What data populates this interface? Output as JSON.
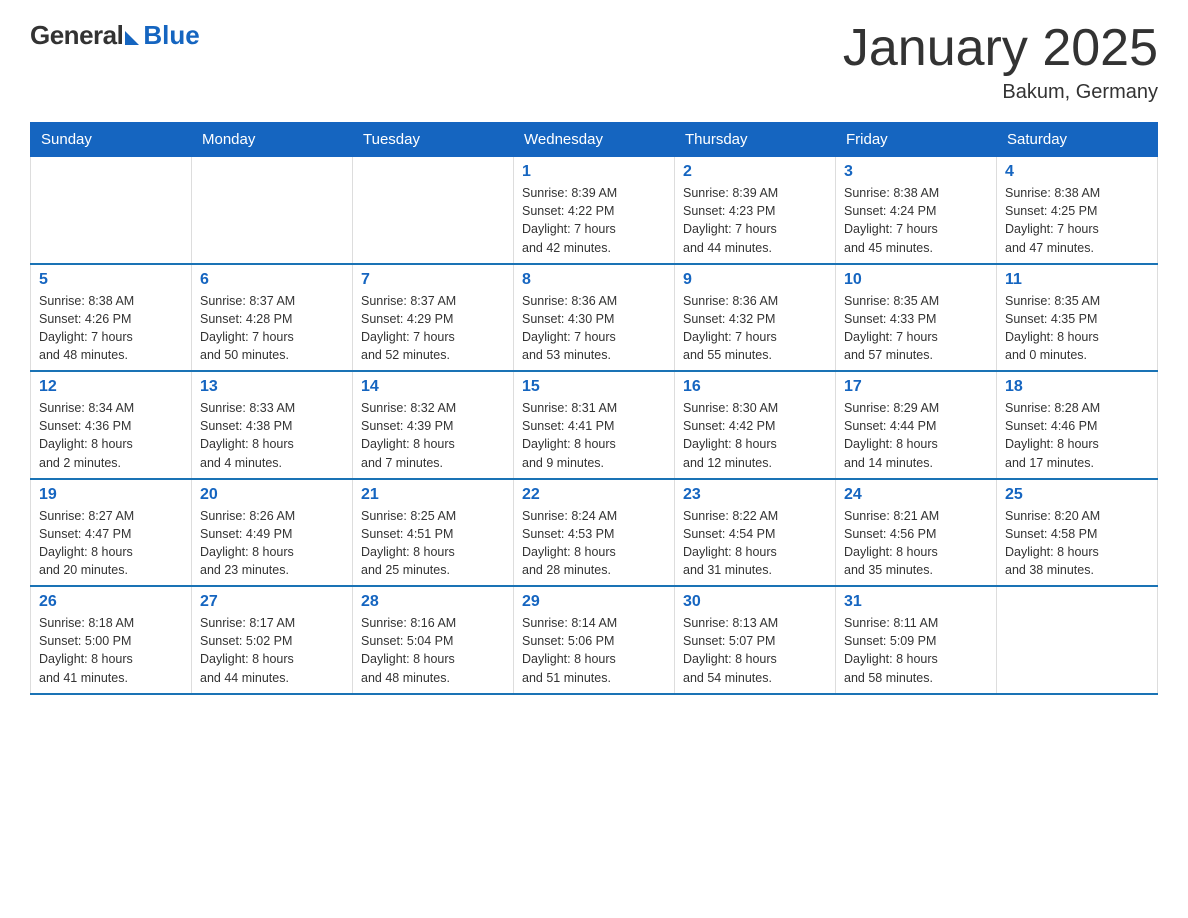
{
  "header": {
    "logo_general": "General",
    "logo_blue": "Blue",
    "title": "January 2025",
    "location": "Bakum, Germany"
  },
  "weekdays": [
    "Sunday",
    "Monday",
    "Tuesday",
    "Wednesday",
    "Thursday",
    "Friday",
    "Saturday"
  ],
  "weeks": [
    [
      {
        "day": "",
        "info": ""
      },
      {
        "day": "",
        "info": ""
      },
      {
        "day": "",
        "info": ""
      },
      {
        "day": "1",
        "info": "Sunrise: 8:39 AM\nSunset: 4:22 PM\nDaylight: 7 hours\nand 42 minutes."
      },
      {
        "day": "2",
        "info": "Sunrise: 8:39 AM\nSunset: 4:23 PM\nDaylight: 7 hours\nand 44 minutes."
      },
      {
        "day": "3",
        "info": "Sunrise: 8:38 AM\nSunset: 4:24 PM\nDaylight: 7 hours\nand 45 minutes."
      },
      {
        "day": "4",
        "info": "Sunrise: 8:38 AM\nSunset: 4:25 PM\nDaylight: 7 hours\nand 47 minutes."
      }
    ],
    [
      {
        "day": "5",
        "info": "Sunrise: 8:38 AM\nSunset: 4:26 PM\nDaylight: 7 hours\nand 48 minutes."
      },
      {
        "day": "6",
        "info": "Sunrise: 8:37 AM\nSunset: 4:28 PM\nDaylight: 7 hours\nand 50 minutes."
      },
      {
        "day": "7",
        "info": "Sunrise: 8:37 AM\nSunset: 4:29 PM\nDaylight: 7 hours\nand 52 minutes."
      },
      {
        "day": "8",
        "info": "Sunrise: 8:36 AM\nSunset: 4:30 PM\nDaylight: 7 hours\nand 53 minutes."
      },
      {
        "day": "9",
        "info": "Sunrise: 8:36 AM\nSunset: 4:32 PM\nDaylight: 7 hours\nand 55 minutes."
      },
      {
        "day": "10",
        "info": "Sunrise: 8:35 AM\nSunset: 4:33 PM\nDaylight: 7 hours\nand 57 minutes."
      },
      {
        "day": "11",
        "info": "Sunrise: 8:35 AM\nSunset: 4:35 PM\nDaylight: 8 hours\nand 0 minutes."
      }
    ],
    [
      {
        "day": "12",
        "info": "Sunrise: 8:34 AM\nSunset: 4:36 PM\nDaylight: 8 hours\nand 2 minutes."
      },
      {
        "day": "13",
        "info": "Sunrise: 8:33 AM\nSunset: 4:38 PM\nDaylight: 8 hours\nand 4 minutes."
      },
      {
        "day": "14",
        "info": "Sunrise: 8:32 AM\nSunset: 4:39 PM\nDaylight: 8 hours\nand 7 minutes."
      },
      {
        "day": "15",
        "info": "Sunrise: 8:31 AM\nSunset: 4:41 PM\nDaylight: 8 hours\nand 9 minutes."
      },
      {
        "day": "16",
        "info": "Sunrise: 8:30 AM\nSunset: 4:42 PM\nDaylight: 8 hours\nand 12 minutes."
      },
      {
        "day": "17",
        "info": "Sunrise: 8:29 AM\nSunset: 4:44 PM\nDaylight: 8 hours\nand 14 minutes."
      },
      {
        "day": "18",
        "info": "Sunrise: 8:28 AM\nSunset: 4:46 PM\nDaylight: 8 hours\nand 17 minutes."
      }
    ],
    [
      {
        "day": "19",
        "info": "Sunrise: 8:27 AM\nSunset: 4:47 PM\nDaylight: 8 hours\nand 20 minutes."
      },
      {
        "day": "20",
        "info": "Sunrise: 8:26 AM\nSunset: 4:49 PM\nDaylight: 8 hours\nand 23 minutes."
      },
      {
        "day": "21",
        "info": "Sunrise: 8:25 AM\nSunset: 4:51 PM\nDaylight: 8 hours\nand 25 minutes."
      },
      {
        "day": "22",
        "info": "Sunrise: 8:24 AM\nSunset: 4:53 PM\nDaylight: 8 hours\nand 28 minutes."
      },
      {
        "day": "23",
        "info": "Sunrise: 8:22 AM\nSunset: 4:54 PM\nDaylight: 8 hours\nand 31 minutes."
      },
      {
        "day": "24",
        "info": "Sunrise: 8:21 AM\nSunset: 4:56 PM\nDaylight: 8 hours\nand 35 minutes."
      },
      {
        "day": "25",
        "info": "Sunrise: 8:20 AM\nSunset: 4:58 PM\nDaylight: 8 hours\nand 38 minutes."
      }
    ],
    [
      {
        "day": "26",
        "info": "Sunrise: 8:18 AM\nSunset: 5:00 PM\nDaylight: 8 hours\nand 41 minutes."
      },
      {
        "day": "27",
        "info": "Sunrise: 8:17 AM\nSunset: 5:02 PM\nDaylight: 8 hours\nand 44 minutes."
      },
      {
        "day": "28",
        "info": "Sunrise: 8:16 AM\nSunset: 5:04 PM\nDaylight: 8 hours\nand 48 minutes."
      },
      {
        "day": "29",
        "info": "Sunrise: 8:14 AM\nSunset: 5:06 PM\nDaylight: 8 hours\nand 51 minutes."
      },
      {
        "day": "30",
        "info": "Sunrise: 8:13 AM\nSunset: 5:07 PM\nDaylight: 8 hours\nand 54 minutes."
      },
      {
        "day": "31",
        "info": "Sunrise: 8:11 AM\nSunset: 5:09 PM\nDaylight: 8 hours\nand 58 minutes."
      },
      {
        "day": "",
        "info": ""
      }
    ]
  ]
}
